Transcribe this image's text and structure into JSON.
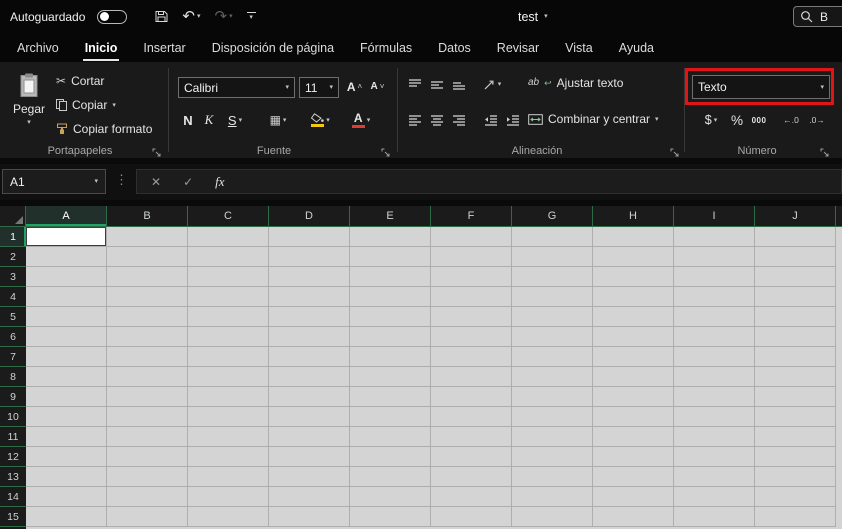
{
  "titlebar": {
    "autosave_label": "Autoguardado",
    "doc_title": "test",
    "search_text": "B"
  },
  "tabs": {
    "items": [
      {
        "label": "Archivo"
      },
      {
        "label": "Inicio"
      },
      {
        "label": "Insertar"
      },
      {
        "label": "Disposición de página"
      },
      {
        "label": "Fórmulas"
      },
      {
        "label": "Datos"
      },
      {
        "label": "Revisar"
      },
      {
        "label": "Vista"
      },
      {
        "label": "Ayuda"
      }
    ],
    "active_tab": "Inicio"
  },
  "ribbon": {
    "clipboard": {
      "group_label": "Portapapeles",
      "paste": "Pegar",
      "cut": "Cortar",
      "copy": "Copiar",
      "format_painter": "Copiar formato"
    },
    "font": {
      "group_label": "Fuente",
      "font_name": "Calibri",
      "font_size": "11",
      "bold": "N",
      "italic": "K",
      "underline": "S",
      "grow_font": "A",
      "shrink_font": "A"
    },
    "alignment": {
      "group_label": "Alineación",
      "wrap_icon_text": "ab",
      "wrap_text": "Ajustar texto",
      "merge_center": "Combinar y centrar"
    },
    "number": {
      "group_label": "Número",
      "format_selected": "Texto",
      "currency": "$",
      "percent": "%",
      "thousands": "000",
      "inc_decimal": "←.0",
      "dec_decimal": ".0→"
    }
  },
  "formula_bar": {
    "name_box": "A1",
    "cancel": "✕",
    "enter": "✓",
    "fx_label": "fx"
  },
  "grid": {
    "columns": [
      "A",
      "B",
      "C",
      "D",
      "E",
      "F",
      "G",
      "H",
      "I",
      "J"
    ],
    "rows": [
      "1",
      "2",
      "3",
      "4",
      "5",
      "6",
      "7",
      "8",
      "9",
      "10",
      "11",
      "12",
      "13",
      "14",
      "15"
    ],
    "selected_cell": "A1"
  },
  "colors": {
    "annotation_red": "#e01515",
    "excel_green": "#21a366",
    "header_line_green": "#2f6b47",
    "fill_yellow": "#f2c811",
    "font_color_red": "#e03c32"
  }
}
